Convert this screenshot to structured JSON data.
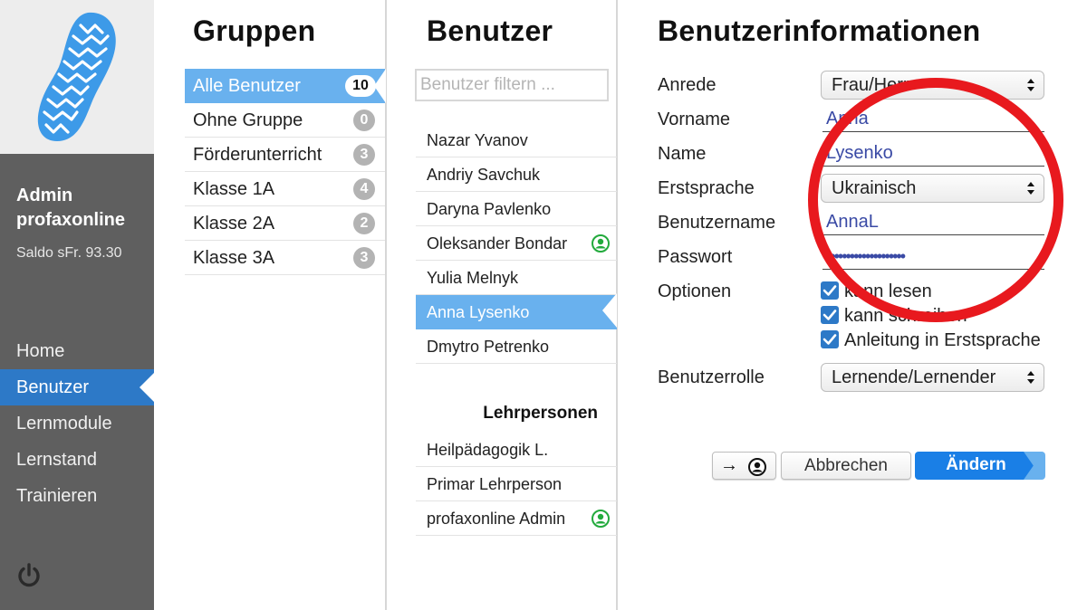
{
  "sidebar": {
    "admin_name": "Admin profaxonline",
    "saldo": "Saldo sFr. 93.30",
    "nav": [
      {
        "label": "Home",
        "active": false
      },
      {
        "label": "Benutzer",
        "active": true
      },
      {
        "label": "Lernmodule",
        "active": false
      },
      {
        "label": "Lernstand",
        "active": false
      },
      {
        "label": "Trainieren",
        "active": false
      }
    ],
    "power_icon": "power-icon",
    "logo_icon": "footprint-icon",
    "accent": "#2d79c7"
  },
  "groups": {
    "title": "Gruppen",
    "items": [
      {
        "label": "Alle Benutzer",
        "count": "10",
        "active": true
      },
      {
        "label": "Ohne Gruppe",
        "count": "0",
        "active": false
      },
      {
        "label": "Förderunterricht",
        "count": "3",
        "active": false
      },
      {
        "label": "Klasse 1A",
        "count": "4",
        "active": false
      },
      {
        "label": "Klasse 2A",
        "count": "2",
        "active": false
      },
      {
        "label": "Klasse 3A",
        "count": "3",
        "active": false
      }
    ]
  },
  "users": {
    "title": "Benutzer",
    "filter_placeholder": "Benutzer filtern ...",
    "items": [
      {
        "name": "Nazar Yvanov",
        "online": false,
        "active": false
      },
      {
        "name": "Andriy Savchuk",
        "online": false,
        "active": false
      },
      {
        "name": "Daryna Pavlenko",
        "online": false,
        "active": false
      },
      {
        "name": "Oleksander Bondar",
        "online": true,
        "active": false
      },
      {
        "name": "Yulia Melnyk",
        "online": false,
        "active": false
      },
      {
        "name": "Anna Lysenko",
        "online": false,
        "active": true
      },
      {
        "name": "Dmytro Petrenko",
        "online": false,
        "active": false
      }
    ],
    "teachers_title": "Lehrpersonen",
    "teachers": [
      {
        "name": "Heilpädagogik L.",
        "online": false
      },
      {
        "name": "Primar Lehrperson",
        "online": false
      },
      {
        "name": "profaxonline Admin",
        "online": true
      }
    ],
    "online_color": "#22aa3c"
  },
  "form": {
    "title": "Benutzerinformationen",
    "labels": {
      "anrede": "Anrede",
      "vorname": "Vorname",
      "name": "Name",
      "erstsprache": "Erstsprache",
      "benutzername": "Benutzername",
      "passwort": "Passwort",
      "optionen": "Optionen",
      "benutzerrolle": "Benutzerrolle"
    },
    "values": {
      "anrede": "Frau/Herr",
      "vorname": "Anna",
      "name": "Lysenko",
      "erstsprache": "Ukrainisch",
      "benutzername": "AnnaL",
      "passwort": "••••••••••••••••••••",
      "benutzerrolle": "Lernende/Lernender"
    },
    "options": [
      {
        "label": "kann lesen",
        "checked": true
      },
      {
        "label": "kann schreiben",
        "checked": true
      },
      {
        "label": "Anleitung in Erstsprache",
        "checked": true
      }
    ],
    "buttons": {
      "login_as": "→",
      "cancel": "Abbrechen",
      "change": "Ändern"
    }
  },
  "annotation": {
    "color": "#e8191e"
  }
}
